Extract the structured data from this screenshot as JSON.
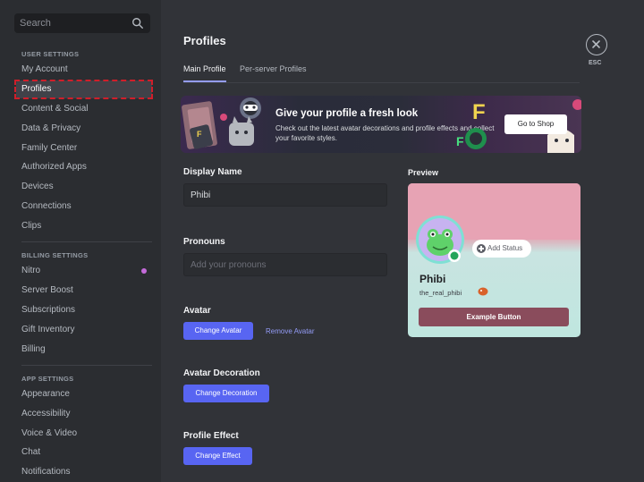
{
  "sidebar": {
    "search_placeholder": "Search",
    "sections": [
      {
        "heading": "USER SETTINGS",
        "items": [
          "My Account",
          "Profiles",
          "Content & Social",
          "Data & Privacy",
          "Family Center",
          "Authorized Apps",
          "Devices",
          "Connections",
          "Clips"
        ]
      },
      {
        "heading": "BILLING SETTINGS",
        "items": [
          "Nitro",
          "Server Boost",
          "Subscriptions",
          "Gift Inventory",
          "Billing"
        ]
      },
      {
        "heading": "APP SETTINGS",
        "items": [
          "Appearance",
          "Accessibility",
          "Voice & Video",
          "Chat",
          "Notifications"
        ]
      }
    ],
    "selected_item": "Profiles"
  },
  "main": {
    "title": "Profiles",
    "tabs": [
      {
        "label": "Main Profile",
        "active": true
      },
      {
        "label": "Per-server Profiles",
        "active": false
      }
    ],
    "esc_label": "ESC",
    "banner": {
      "title": "Give your profile a fresh look",
      "subtitle": "Check out the latest avatar decorations and profile effects and collect your favorite styles.",
      "button": "Go to Shop"
    },
    "display_name": {
      "label": "Display Name",
      "value": "Phibi"
    },
    "pronouns": {
      "label": "Pronouns",
      "placeholder": "Add your pronouns"
    },
    "avatar": {
      "label": "Avatar",
      "change": "Change Avatar",
      "remove": "Remove Avatar"
    },
    "avatar_decoration": {
      "label": "Avatar Decoration",
      "change": "Change Decoration"
    },
    "profile_effect": {
      "label": "Profile Effect",
      "change": "Change Effect"
    }
  },
  "preview": {
    "label": "Preview",
    "add_status": "Add Status",
    "name": "Phibi",
    "username": "the_real_phibi",
    "button": "Example Button"
  },
  "colors": {
    "accent": "#5865f2",
    "highlight": "#d01e2a",
    "card_button": "#8a4c5c",
    "nitro_dot": "#c46bd9"
  }
}
